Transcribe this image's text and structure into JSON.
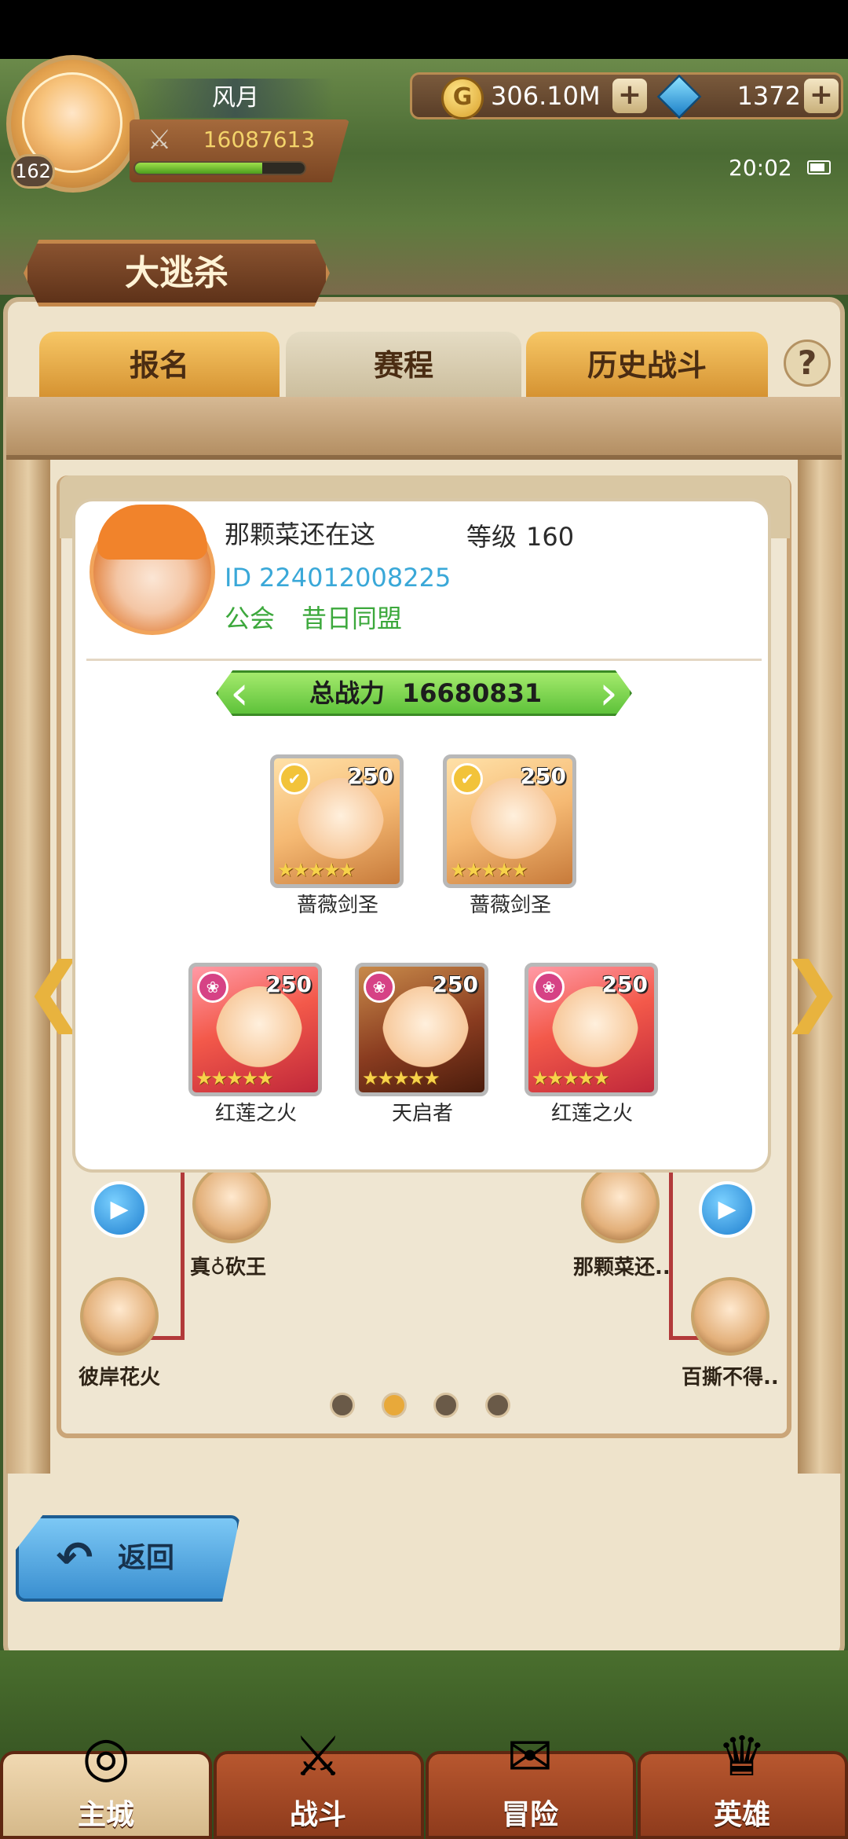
{
  "player": {
    "name": "风月",
    "level": "162",
    "power": "16087613",
    "exp_fraction": 0.75
  },
  "currency": {
    "gold": "306.10M",
    "gems": "1372"
  },
  "status": {
    "time": "20:02"
  },
  "page": {
    "title": "大逃杀",
    "tabs": [
      "报名",
      "赛程",
      "历史战斗"
    ],
    "help_label": "?",
    "back_label": "返回",
    "page_dots": 4,
    "active_dot": 1
  },
  "bracket": {
    "left_names": [
      "真♁砍王",
      "彼岸花火"
    ],
    "right_names": [
      "那颗菜还..",
      "百撕不得.."
    ]
  },
  "profile": {
    "name": "那颗菜还在这",
    "level_label": "等级",
    "level": "160",
    "id_label": "ID",
    "id": "224012008225",
    "guild_label": "公会",
    "guild": "昔日同盟",
    "power_label": "总战力",
    "power_total": "16680831",
    "heroes": [
      {
        "name": "蔷薇剑圣",
        "level": "250",
        "stars": "★★★★★",
        "badge": "gold"
      },
      {
        "name": "蔷薇剑圣",
        "level": "250",
        "stars": "★★★★★",
        "badge": "gold"
      },
      {
        "name": "红莲之火",
        "level": "250",
        "stars": "★★★★★",
        "badge": "pink"
      },
      {
        "name": "天启者",
        "level": "250",
        "stars": "★★★★★",
        "badge": "pink"
      },
      {
        "name": "红莲之火",
        "level": "250",
        "stars": "★★★★★",
        "badge": "pink"
      }
    ]
  },
  "bottom_nav": [
    "主城",
    "战斗",
    "冒险",
    "英雄"
  ],
  "icons": {
    "coin": "G",
    "plus": "+",
    "swords": "⚔",
    "back": "↶",
    "left_arrow": "❮",
    "right_arrow": "❯",
    "play": "▶",
    "badge_gold": "✔",
    "badge_pink": "❀"
  },
  "colors": {
    "accent_gold": "#e8a93a",
    "id_blue": "#3aa8d8",
    "guild_green": "#3ca83c",
    "power_green": "#5ec23a"
  }
}
